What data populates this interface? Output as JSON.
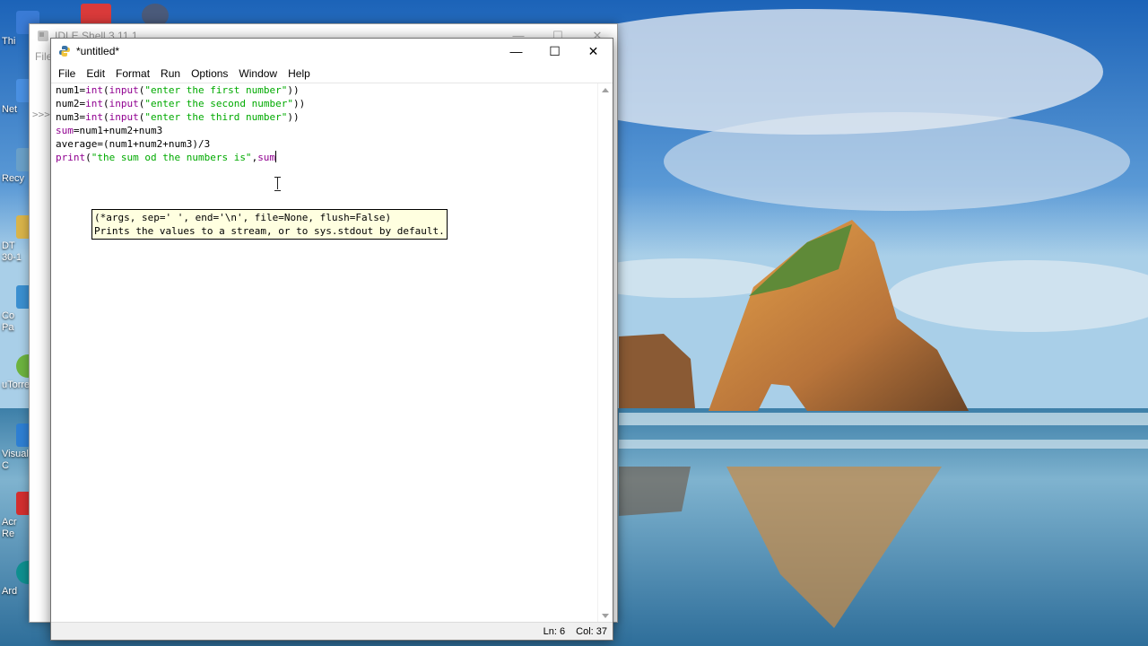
{
  "desktop": {
    "icons": [
      {
        "label": "Thi",
        "color": "#3a7bd5"
      },
      {
        "label": "Net",
        "color": "#4a90e2"
      },
      {
        "label": "Recy",
        "color": "#6aa0c8"
      },
      {
        "label": "DT\n30-1",
        "color": "#d9b44a"
      },
      {
        "label": "Co\nPa",
        "color": "#3b8fd0"
      },
      {
        "label": "uTorre",
        "color": "#6db33f"
      },
      {
        "label": "Visual\nC",
        "color": "#2e7fd3"
      },
      {
        "label": "Acr\nRe",
        "color": "#d32f2f"
      },
      {
        "label": "Ard",
        "color": "#0f8f8f"
      }
    ]
  },
  "shell_window": {
    "title": "IDLE Shell 3.11.1",
    "menu_first": "File",
    "prompt": ">>>"
  },
  "editor": {
    "title": "*untitled*",
    "window_buttons": {
      "minimize": "—",
      "maximize": "☐",
      "close": "✕"
    },
    "menu": [
      "File",
      "Edit",
      "Format",
      "Run",
      "Options",
      "Window",
      "Help"
    ],
    "code_lines": [
      "num1=int(input(\"enter the first number\"))",
      "num2=int(input(\"enter the second number\"))",
      "num3=int(input(\"enter the third number\"))",
      "sum=num1+num2+num3",
      "average=(num1+num2+num3)/3",
      "print(\"the sum od the numbers is\",sum"
    ],
    "calltip": {
      "signature": "(*args, sep=' ', end='\\n', file=None, flush=False)",
      "description": "Prints the values to a stream, or to sys.stdout by default."
    },
    "status": {
      "line": "Ln: 6",
      "col": "Col: 37"
    }
  }
}
